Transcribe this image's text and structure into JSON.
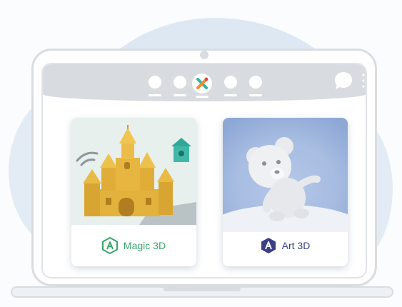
{
  "colors": {
    "accent_magic": "#3aa66a",
    "accent_art": "#3a3f86",
    "topbar": "#d8dce1",
    "frame": "#d9dde2"
  },
  "nav": {
    "items": [
      {
        "icon": "nav-dot"
      },
      {
        "icon": "nav-dot"
      },
      {
        "icon": "app-logo-icon",
        "active": true
      },
      {
        "icon": "nav-dot"
      },
      {
        "icon": "nav-dot"
      }
    ],
    "chat_icon": "chat-bubble-icon",
    "menu_icon": "kebab-menu-icon"
  },
  "cards": {
    "magic": {
      "label": "Magic 3D",
      "image": "castle-scene",
      "icon": "magic-3d-logo-icon"
    },
    "art": {
      "label": "Art 3D",
      "image": "teddy-bear-sculpture",
      "icon": "art-3d-logo-icon"
    }
  }
}
